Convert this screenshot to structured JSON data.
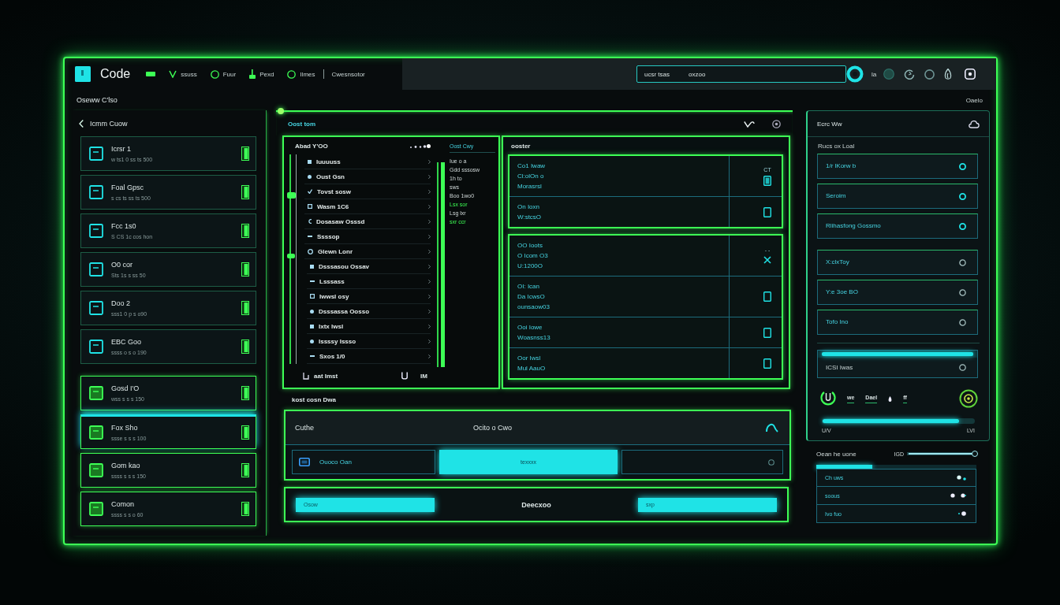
{
  "window": {
    "logo": "Code",
    "nav": [
      {
        "kind": "bar"
      },
      {
        "kind": "check",
        "label": "ssuss"
      },
      {
        "kind": "ring",
        "label": "Fuur"
      },
      {
        "kind": "plug",
        "label": "Pexd"
      },
      {
        "kind": "ring",
        "label": "Ilmes"
      },
      {
        "kind": "divider",
        "label": "Cwesnsotor"
      }
    ],
    "search": {
      "value": "ucsr tsas",
      "tag": "oxzoo"
    },
    "account_label": "la"
  },
  "subheader": {
    "title": "Oseww C'lso",
    "corner": "Oaelo"
  },
  "sidebar": {
    "title": "Icmm Cuow",
    "items": [
      {
        "title": "Icrsr 1",
        "subtitle": "w ts1 0 ss ts 500",
        "highlighted": false,
        "selected": false
      },
      {
        "title": "Foal Gpsc",
        "subtitle": "s cs ts ss ts 500",
        "highlighted": false,
        "selected": false
      },
      {
        "title": "Fcc 1s0",
        "subtitle": "S CS 1c cos hon",
        "highlighted": false,
        "selected": false
      },
      {
        "title": "O0 cor",
        "subtitle": "Sts 1s s ss 50",
        "highlighted": false,
        "selected": false
      },
      {
        "title": "Doo 2",
        "subtitle": "sss1 0 p s o90",
        "highlighted": false,
        "selected": false
      },
      {
        "title": "EBC Goo",
        "subtitle": "ssss o s o 190",
        "highlighted": false,
        "selected": false
      },
      {
        "title": "Gosd I'O",
        "subtitle": "wss s s s 150",
        "highlighted": true,
        "selected": false
      },
      {
        "title": "Fox Sho",
        "subtitle": "ssse s s s 100",
        "highlighted": true,
        "selected": true
      },
      {
        "title": "Gom kao",
        "subtitle": "ssss s s s 150",
        "highlighted": true,
        "selected": false
      },
      {
        "title": "Comon",
        "subtitle": "ssss s s o 60",
        "highlighted": true,
        "selected": false
      }
    ]
  },
  "editor": {
    "title": "Oost tom",
    "tree": {
      "title": "Abad Y'OO",
      "items": [
        {
          "kind": "square",
          "label": "Iuuuuss"
        },
        {
          "kind": "dot",
          "label": "Oust Gsn"
        },
        {
          "kind": "check",
          "label": "Tovst sosw"
        },
        {
          "kind": "box",
          "label": "Wasm 1C6"
        },
        {
          "kind": "half",
          "label": "Dosasaw Osssd"
        },
        {
          "kind": "dash",
          "label": "Ssssop"
        },
        {
          "kind": "ring",
          "label": "Glewn Lonr",
          "children": [
            {
              "kind": "square",
              "label": "Dsssasou Ossav"
            },
            {
              "kind": "dash",
              "label": "Lsssass"
            },
            {
              "kind": "box",
              "label": "Iwwsl osy"
            },
            {
              "kind": "dot",
              "label": "Dsssassa Oosso"
            },
            {
              "kind": "square",
              "label": "Ixtx lwsl"
            },
            {
              "kind": "dot",
              "label": "Issssy Issso"
            },
            {
              "kind": "dash",
              "label": "Sxos 1/0"
            }
          ]
        }
      ],
      "footer": "aat Imst",
      "footer_tag": "IM"
    },
    "side_list": {
      "title": "Oost Cwy",
      "lines": [
        {
          "text": "Iue o a",
          "accent": false
        },
        {
          "text": "Gdd sssosw",
          "accent": false
        },
        {
          "text": "1h to",
          "accent": false
        },
        {
          "text": "sws",
          "accent": false
        },
        {
          "text": "Boo 1wo0",
          "accent": false
        },
        {
          "text": "Lsx sor",
          "accent": true
        },
        {
          "text": "Lsg lxr",
          "accent": false
        },
        {
          "text": "sxr ccr",
          "accent": true
        }
      ]
    },
    "list": {
      "title": "ooster",
      "groups": [
        {
          "rows": [
            {
              "lines": [
                "Co1 Iwaw",
                "Cl:olOn o",
                "Morasrsl"
              ],
              "tag": "CT",
              "checked": true,
              "crossed": false
            },
            {
              "lines": [
                "On Ioxn",
                "W:stcsO"
              ],
              "checked": false,
              "crossed": false
            }
          ]
        },
        {
          "rows": [
            {
              "lines": [
                "OO Ioots",
                "O Icom O3",
                "U:1200O"
              ],
              "tag": "- -",
              "checked": false,
              "crossed": true
            },
            {
              "lines": [
                "OI: Ican",
                "Da IcwsO",
                "ounsaow03"
              ],
              "checked": false,
              "crossed": false
            },
            {
              "lines": [
                "Ooi Iowe",
                "Woasnss13"
              ],
              "checked": false,
              "crossed": false
            },
            {
              "lines": [
                "Oor Iwsl",
                "Mul AauO"
              ],
              "checked": false,
              "crossed": false
            }
          ]
        }
      ]
    }
  },
  "form": {
    "caption": "kost cosn Dwa",
    "header_left": "Cuthe",
    "header_center": "Ocito o Cwo",
    "field_label": "Ouoco Oan",
    "field_value": "texxxx",
    "actions": [
      "Osow",
      "sxp"
    ],
    "status": "Deecxoo"
  },
  "settings": {
    "title": "Ecrc Ww",
    "subtitle": "Rucs ox Loal",
    "options": [
      {
        "label": "1/r lKorw b",
        "on": true
      },
      {
        "label": "Seroim",
        "on": true
      },
      {
        "label": "Rlihasfong Gossmo",
        "on": true
      },
      {
        "label": "X:clxToy",
        "on": false
      },
      {
        "label": "Y:e 3oe BO",
        "on": false
      },
      {
        "label": "Tofo Ino",
        "on": false
      }
    ],
    "meter": {
      "label": "ICSI Iwas",
      "level": 1
    },
    "controls": [
      "we",
      "Dael",
      "ff"
    ],
    "range": {
      "level": 0.9,
      "min_label": "U/V",
      "max_label": "LVI"
    }
  },
  "mixer": {
    "title": "Oean he uone",
    "slider": {
      "label": "IGD",
      "level": 1
    },
    "progress": {
      "level": 0.35
    },
    "rows": [
      {
        "kind": "toggle",
        "label": "Ch uws"
      },
      {
        "kind": "pair",
        "label": "soous"
      },
      {
        "kind": "dot",
        "label": "Ivo fuo"
      }
    ]
  }
}
